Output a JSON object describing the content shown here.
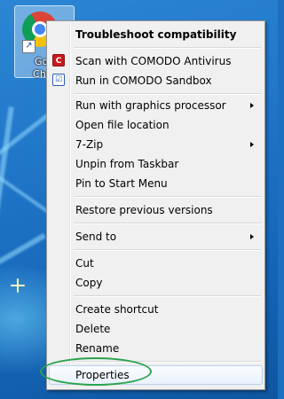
{
  "desktop_icon": {
    "label": "Goo\nChro",
    "icon": "google-chrome-icon",
    "overlay": "shortcut-arrow-icon",
    "overlay_glyph": "↗"
  },
  "context_menu": {
    "items": [
      {
        "label": "Troubleshoot compatibility",
        "bold": true
      },
      {
        "label": "Scan with COMODO Antivirus",
        "icon": "comodo-antivirus-icon",
        "glyph": "C"
      },
      {
        "label": "Run in COMODO Sandbox",
        "icon": "comodo-sandbox-icon",
        "glyph": "☑"
      },
      {
        "label": "Run with graphics processor",
        "submenu": true
      },
      {
        "label": "Open file location"
      },
      {
        "label": "7-Zip",
        "submenu": true
      },
      {
        "label": "Unpin from Taskbar"
      },
      {
        "label": "Pin to Start Menu"
      },
      {
        "label": "Restore previous versions"
      },
      {
        "label": "Send to",
        "submenu": true
      },
      {
        "label": "Cut"
      },
      {
        "label": "Copy"
      },
      {
        "label": "Create shortcut"
      },
      {
        "label": "Delete"
      },
      {
        "label": "Rename"
      },
      {
        "label": "Properties",
        "hovered": true,
        "annotated": true
      }
    ]
  },
  "colors": {
    "menu_bg": "#f0f0f0",
    "menu_border": "#979797",
    "hover_bg": "#e8f1fb",
    "annotation": "#2aa24a",
    "desktop": "#1f74c6"
  }
}
